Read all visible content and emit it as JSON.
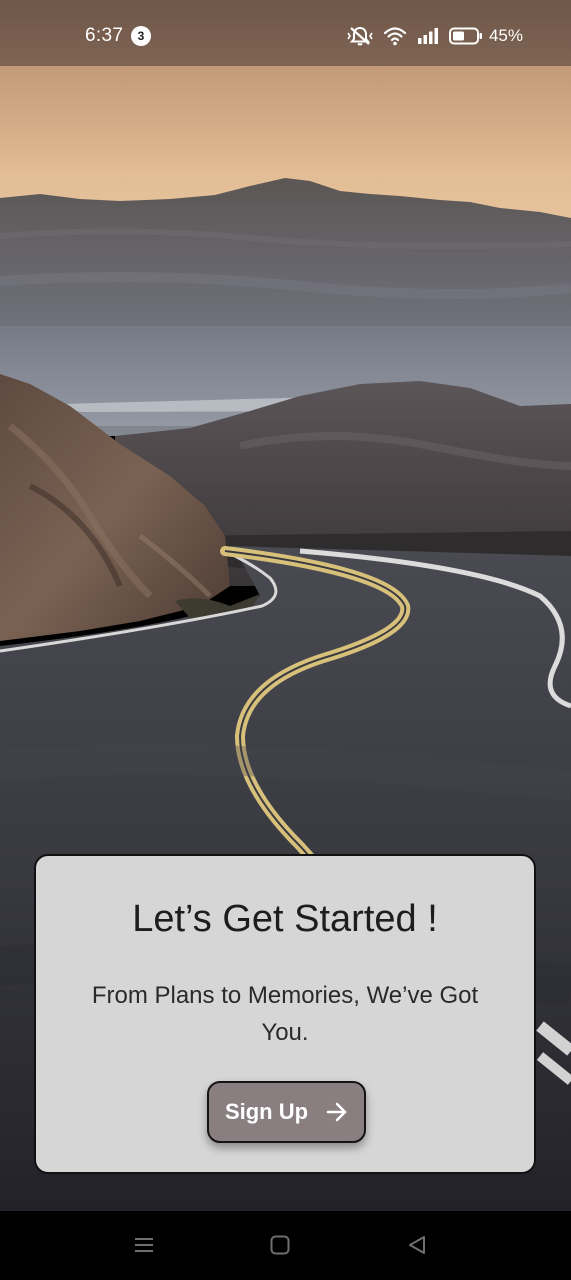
{
  "status_bar": {
    "time": "6:37",
    "notification_count": "3",
    "battery_percent": "45%",
    "icons": [
      "mute-vibrate-icon",
      "wifi-icon",
      "signal-icon",
      "battery-icon"
    ]
  },
  "hero": {
    "image": "winding-desert-road-with-mountains"
  },
  "card": {
    "title": "Let’s Get Started !",
    "subtitle": "From Plans to Memories, We’ve Got You.",
    "signup_label": "Sign Up",
    "signup_icon": "arrow-right-icon"
  },
  "nav_bar": {
    "buttons": [
      "menu-icon",
      "home-icon",
      "back-icon"
    ]
  },
  "colors": {
    "card_background": "#d6d6d6",
    "button_background": "#8a7f80",
    "status_bar": "#765d4d"
  }
}
